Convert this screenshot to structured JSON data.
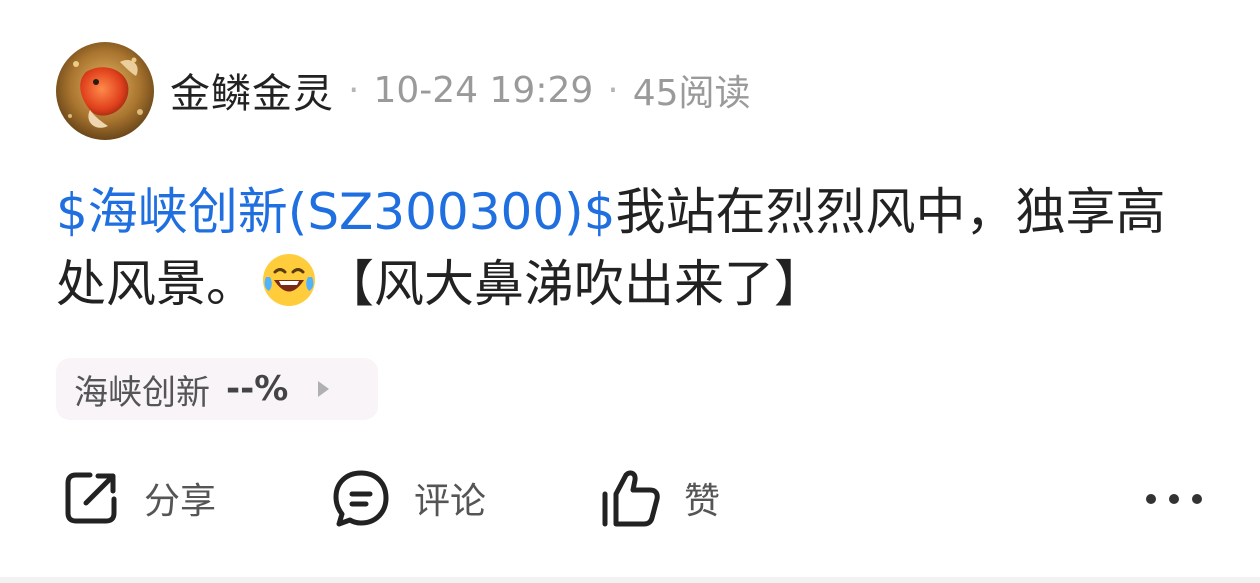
{
  "author": {
    "name": "金鳞金灵",
    "time": "10-24 19:29",
    "reads": "45阅读",
    "separator": "·"
  },
  "post": {
    "stock_tag": "$海峡创新(SZ300300)$",
    "text_line1": "我站在烈烈风中，独享高处风景。",
    "text_after_emoji": "【风大鼻涕吹出来了】",
    "emoji": "laughing-tears-emoji"
  },
  "stock_chip": {
    "name": "海峡创新",
    "change": "--%"
  },
  "actions": {
    "share": "分享",
    "comment": "评论",
    "like": "赞"
  },
  "colors": {
    "link": "#1f6fe0",
    "text": "#222222",
    "meta": "#9a9a9a",
    "chip_bg": "#f8f4f8"
  }
}
